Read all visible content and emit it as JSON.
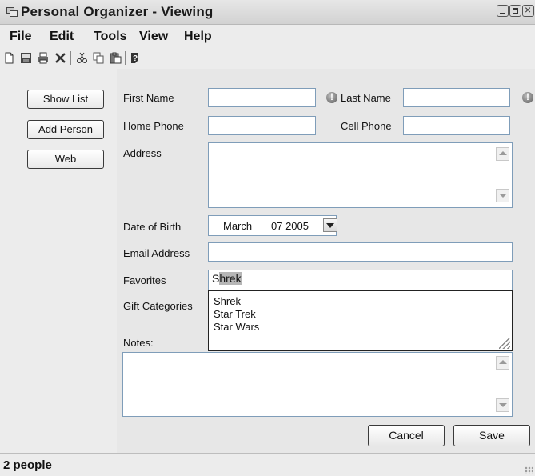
{
  "window": {
    "title": "Personal Organizer - Viewing",
    "app_icon": "window-app-icon",
    "controls": [
      "minimize-icon",
      "maximize-icon",
      "close-icon"
    ]
  },
  "menu": {
    "items": [
      "File",
      "Edit",
      "Tools",
      "View",
      "Help"
    ]
  },
  "toolbar": {
    "icons": [
      "new-document-icon",
      "save-icon",
      "print-icon",
      "delete-icon",
      "cut-icon",
      "copy-icon",
      "paste-icon",
      "help-icon"
    ]
  },
  "sidebar": {
    "show_list": "Show List",
    "add_person": "Add Person",
    "web": "Web"
  },
  "form": {
    "first_name_label": "First Name",
    "first_name_value": "",
    "last_name_label": "Last Name",
    "last_name_value": "",
    "home_phone_label": "Home Phone",
    "home_phone_value": "",
    "cell_phone_label": "Cell Phone",
    "cell_phone_value": "",
    "address_label": "Address",
    "address_value": "",
    "dob_label": "Date of Birth",
    "dob_month": "March",
    "dob_day_year": "07 2005",
    "email_label": "Email Address",
    "email_value": "",
    "favorites_label": "Favorites",
    "favorites_typed": "S",
    "favorites_autocomplete": "hrek",
    "gift_label": "Gift Categories",
    "notes_label": "Notes:",
    "notes_value": "",
    "suggestions": [
      "Shrek",
      "Star Trek",
      "Star Wars"
    ]
  },
  "buttons": {
    "cancel": "Cancel",
    "save": "Save"
  },
  "status": {
    "text": "2 people"
  },
  "colors": {
    "window_bg": "#ececec",
    "field_border": "#7f9db9",
    "selection": "#b6b6b6"
  }
}
